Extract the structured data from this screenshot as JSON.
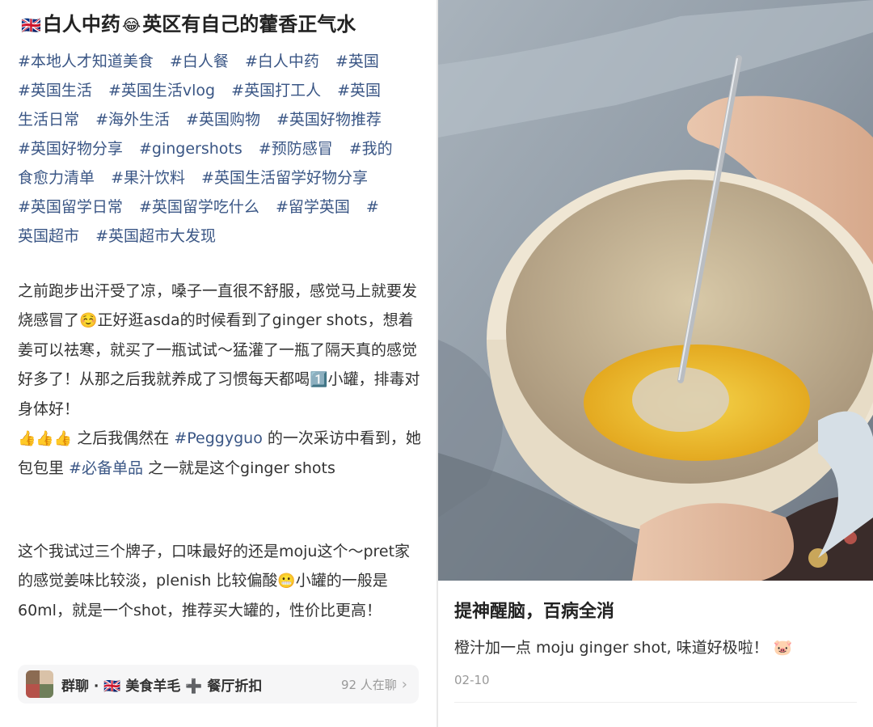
{
  "left": {
    "title_flag": "🇬🇧",
    "title_part1": "白人中药",
    "title_emoji": "😂",
    "title_part2": "英区有自己的藿香正气水",
    "tags": [
      "#本地人才知道美食",
      "#白人餐",
      "#白人中药",
      "#英国",
      "#英国生活",
      "#英国生活vlog",
      "#英国打工人",
      "#英国",
      "生活日常",
      "#海外生活",
      "#英国购物",
      "#英国好物推荐",
      "#英国好物分享",
      "#gingershots",
      "#预防感冒",
      "#我的",
      "食愈力清单",
      "#果汁饮料",
      "#英国生活留学好物分享",
      "#英国留学日常",
      "#英国留学吃什么",
      "#留学英国",
      "#",
      "英国超市",
      "#英国超市大发现"
    ],
    "p1_a": "之前跑步出汗受了凉，嗓子一直很不舒服，感觉马上就要发烧感冒了",
    "p1_emoji1": "☺️",
    "p1_b": "正好逛asda的时候看到了ginger shots，想着姜可以祛寒，就买了一瓶试试～猛灌了一瓶了隔天真的感觉好多了！从那之后我就养成了习惯每天都喝",
    "p1_emoji2": "1️⃣",
    "p1_c": "小罐，排毒对身体好！",
    "p1_thumbs": "👍👍👍",
    "p1_d": " 之后我偶然在 ",
    "p1_mention": "#Peggyguo",
    "p1_e": " 的一次采访中看到，她包包里 ",
    "p1_mention2": "#必备单品",
    "p1_f": " 之一就是这个ginger shots",
    "p2_a": "这个我试过三个牌子，口味最好的还是moju这个～pret家的感觉姜味比较淡，plenish 比较偏酸",
    "p2_emoji": "😬",
    "p2_b": "小罐的一般是60ml，就是一个shot，推荐买大罐的，性价比更高！",
    "chat_label": "群聊 · 🇬🇧 美食羊毛 ➕ 餐厅折扣",
    "chat_count": "92 人在聊",
    "chat_chevron": "›"
  },
  "right": {
    "title": "提神醒脑，百病全消",
    "desc": "橙汁加一点 moju ginger shot, 味道好极啦！",
    "desc_emoji": "🐷",
    "date": "02-10"
  },
  "colors": {
    "tag_blue": "#3a5685",
    "text": "#333333",
    "muted": "#999999"
  }
}
